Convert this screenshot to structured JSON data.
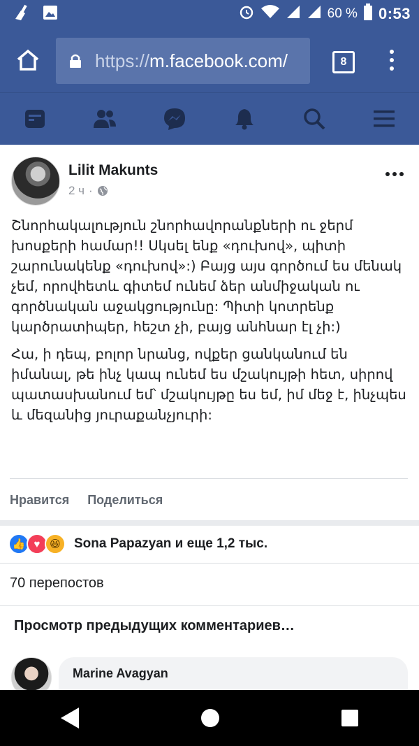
{
  "status_bar": {
    "battery": "60 %",
    "time": "0:53"
  },
  "browser": {
    "url_scheme": "https://",
    "url_host": "m.facebook.com/",
    "tab_count": "8"
  },
  "post": {
    "author": "Lilit Makunts",
    "time_ago": "2 ч",
    "meta_separator": "·",
    "paragraphs": [
      "Շնորհակալություն շնորհավորանքների ու ջերմ խոսքերի համար!! Սկսել ենք «դուխով», պիտի շարունակենք «դուխով»:) Բայց այս գործում ես մենակ չեմ, որովհետև գիտեմ ունեմ ձեր անմիջական ու գործնական աջակցությունը: Պիտի կոտրենք կարծրատիպեր, հեշտ չի, բայց անհնար էլ չի:)",
      "Հա, ի դեպ, բոլոր նրանց, ովքեր ցանկանում են իմանալ, թե ինչ կապ ունեմ ես մշակույթի հետ, սիրով պատասխանում եմ՝ մշակույթը ես եմ, իմ մեջ է, ինչպես և մեզանից յուրաքանչյուրի:"
    ],
    "actions": {
      "like": "Нравится",
      "share": "Поделиться"
    },
    "reactions_text": "Sona Papazyan и еще 1,2 тыс.",
    "shares_text": "70 перепостов",
    "prev_comments": "Просмотр предыдущих комментариев…"
  },
  "comment": {
    "author": "Marine Avagyan"
  },
  "icons": {
    "reaction_like": "👍",
    "reaction_love": "♥",
    "reaction_haha": "😆"
  },
  "colors": {
    "brand": "#3b5998",
    "like_blue": "#2078f4",
    "love_red": "#f33e58",
    "haha_yellow": "#f7b125"
  }
}
